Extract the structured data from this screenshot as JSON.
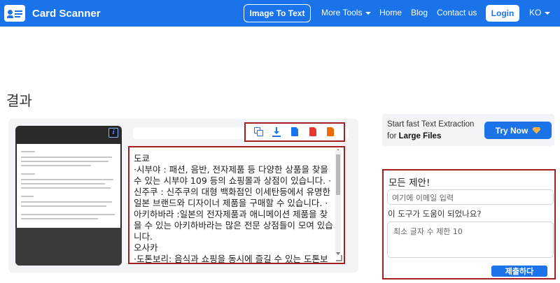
{
  "nav": {
    "brand": "Card Scanner",
    "image_to_text": "Image To Text",
    "more_tools": "More Tools",
    "home": "Home",
    "blog": "Blog",
    "contact": "Contact us",
    "login": "Login",
    "lang": "KO"
  },
  "main": {
    "heading": "결과",
    "result_text": "도쿄\n·시부야 : 패션, 음반, 전자제품 등 다양한 상품을 찾을 수 있는 시부야 109 등의 쇼핑몰과 상점이 있습니다. ·신주쿠 : 신주쿠의 대형 백화점인 이세탄등에서 유명한 일본 브랜드와 디자이너 제품을 구매할 수 있습니다. ·아키하바라 :일본의 전자제품과 애니메이션 제품을 찾을 수 있는 아키하바라는 많은 전문 상점들이 모여 있습니다.\n오사카\n·도톤보리: 음식과 쇼핑을 동시에 즐길 수 있는 도톤보리는 유명한 쇼핑 거리로, 각종 의류, 액세서리, 화장품 등 다양한 상점들이 있습니다."
  },
  "toolbar": {
    "icons": [
      "copy-icon",
      "download-icon",
      "doc-icon",
      "pdf-icon",
      "txt-icon"
    ],
    "colors": {
      "copy": "#1a73e8",
      "download": "#1a73e8",
      "doc": "#1a73e8",
      "pdf": "#e53935",
      "txt": "#ef6c00"
    }
  },
  "promo": {
    "line1": "Start fast Text Extraction",
    "line2_prefix": "for",
    "line2_bold": "Large Files",
    "button": "Try Now"
  },
  "feedback": {
    "title": "모든 제안!",
    "email_placeholder": "여기에 이메일 입력",
    "question": "이 도구가 도움이 되었나요?",
    "textarea_placeholder": "최소 글자 수 제한 10",
    "submit": "제출하다"
  },
  "colors": {
    "brand": "#1a73e8",
    "highlight_border": "#a32020"
  }
}
